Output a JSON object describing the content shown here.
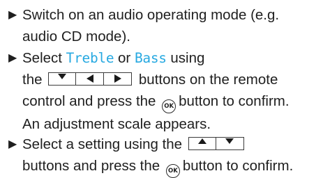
{
  "steps": [
    {
      "lines": [
        "Switch on an audio operating mode (e.g.",
        "audio CD mode)."
      ]
    },
    {
      "line1_prefix": "Select ",
      "treble": "Treble",
      "or": " or ",
      "bass": "Bass",
      "line1_suffix": " using",
      "line2_prefix": "the",
      "line2_suffix": "buttons on the remote",
      "line3_prefix": "control and press the",
      "line3_suffix": "button to confirm.",
      "line4": "An adjustment scale appears."
    },
    {
      "line1_prefix": "Select a setting using the",
      "line2_prefix": "buttons and press the",
      "line2_suffix": "button to confirm."
    }
  ],
  "icons": {
    "bullet": "▶",
    "ok_label": "OK",
    "down": "down-arrow-icon",
    "left": "left-arrow-icon",
    "right": "right-arrow-icon",
    "up": "up-arrow-icon"
  },
  "colors": {
    "highlight": "#27a9e1"
  }
}
